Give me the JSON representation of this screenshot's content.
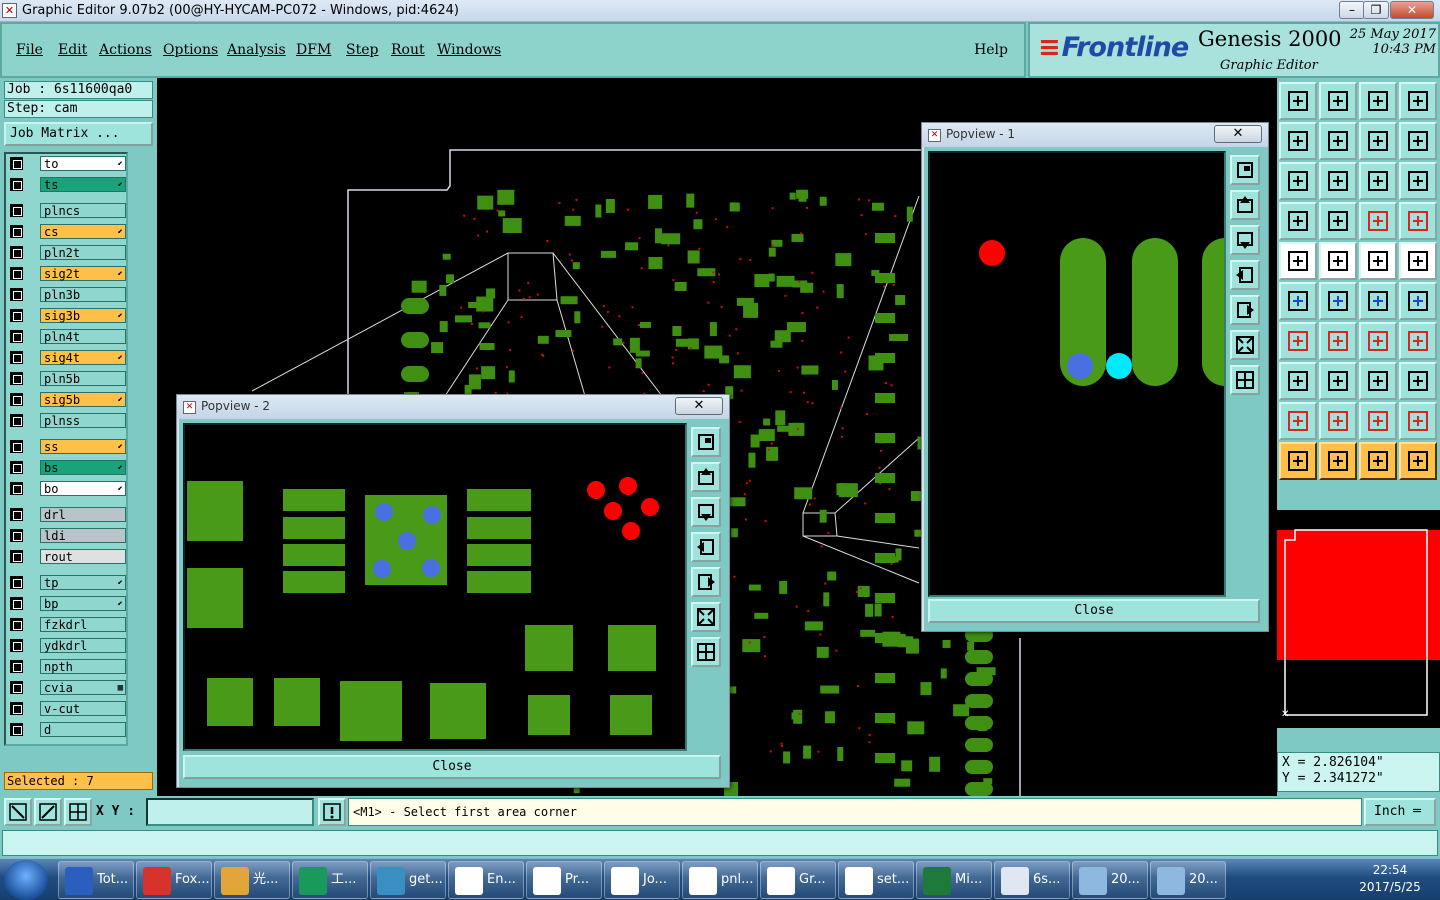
{
  "window": {
    "title": "Graphic Editor 9.07b2 (00@HY-HYCAM-PC072 - Windows, pid:4624)",
    "min": "–",
    "max": "❐",
    "close": "✕"
  },
  "menu": {
    "items": [
      "File",
      "Edit",
      "Actions",
      "Options",
      "Analysis",
      "DFM",
      "Step",
      "Rout",
      "Windows"
    ],
    "help": "Help"
  },
  "brand": {
    "logo": "Frontline",
    "product": "Genesis 2000",
    "subtitle": "Graphic Editor",
    "date": "25 May 2017",
    "time": "10:43 PM"
  },
  "job": {
    "job_line": "Job : 6s11600qa0",
    "step_line": "Step: cam",
    "matrix_button": "Job Matrix ..."
  },
  "layers": [
    {
      "name": "to",
      "color": "#ffffff",
      "mark": "⬋"
    },
    {
      "name": "ts",
      "color": "#1aa37a",
      "mark": "⬋"
    },
    {
      "name": "plncs",
      "color": "#8fd6cf",
      "mark": ""
    },
    {
      "name": "cs",
      "color": "#ffc04a",
      "mark": "⬋"
    },
    {
      "name": "pln2t",
      "color": "#8fd6cf",
      "mark": ""
    },
    {
      "name": "sig2t",
      "color": "#ffc04a",
      "mark": "⬋"
    },
    {
      "name": "pln3b",
      "color": "#8fd6cf",
      "mark": ""
    },
    {
      "name": "sig3b",
      "color": "#ffc04a",
      "mark": "⬋"
    },
    {
      "name": "pln4t",
      "color": "#8fd6cf",
      "mark": ""
    },
    {
      "name": "sig4t",
      "color": "#ffc04a",
      "mark": "⬋"
    },
    {
      "name": "pln5b",
      "color": "#8fd6cf",
      "mark": ""
    },
    {
      "name": "sig5b",
      "color": "#ffc04a",
      "mark": "⬋"
    },
    {
      "name": "plnss",
      "color": "#8fd6cf",
      "mark": ""
    },
    {
      "name": "ss",
      "color": "#ffc04a",
      "mark": "⬋"
    },
    {
      "name": "bs",
      "color": "#1aa37a",
      "mark": "⬋"
    },
    {
      "name": "bo",
      "color": "#ffffff",
      "mark": "⬋"
    },
    {
      "name": "drl",
      "color": "#b9c4c8",
      "mark": ""
    },
    {
      "name": "ldi",
      "color": "#b9c4c8",
      "mark": ""
    },
    {
      "name": "rout",
      "color": "#e0e0e0",
      "mark": ""
    },
    {
      "name": "tp",
      "color": "#8fd6cf",
      "mark": "⬋"
    },
    {
      "name": "bp",
      "color": "#8fd6cf",
      "mark": "⬋"
    },
    {
      "name": "fzkdrl",
      "color": "#8fd6cf",
      "mark": ""
    },
    {
      "name": "ydkdrl",
      "color": "#8fd6cf",
      "mark": ""
    },
    {
      "name": "npth",
      "color": "#8fd6cf",
      "mark": ""
    },
    {
      "name": "cvia",
      "color": "#8fd6cf",
      "mark": "▦"
    },
    {
      "name": "v-cut",
      "color": "#8fd6cf",
      "mark": ""
    },
    {
      "name": "d",
      "color": "#8fd6cf",
      "mark": ""
    }
  ],
  "selected": "Selected : 7",
  "popview1": {
    "title": "Popview - 1",
    "close": "Close",
    "x": "✕"
  },
  "popview2": {
    "title": "Popview - 2",
    "close": "Close",
    "x": "✕"
  },
  "coords": {
    "x_line": "X = 2.826104\"",
    "y_line": "Y = 2.341272\""
  },
  "status": {
    "xy_label": "X Y :",
    "xy_value": "",
    "prompt": "<M1> - Select first area corner",
    "unit": "Inch ═"
  },
  "taskbar": {
    "items": [
      {
        "label": "Tot...",
        "color": "#2b5fbf"
      },
      {
        "label": "Fox...",
        "color": "#d8332b"
      },
      {
        "label": "光...",
        "color": "#e2a53a"
      },
      {
        "label": "工...",
        "color": "#1a9a5a"
      },
      {
        "label": "get...",
        "color": "#3a8fc2"
      },
      {
        "label": "En...",
        "color": "#ffffff"
      },
      {
        "label": "Pr...",
        "color": "#ffffff"
      },
      {
        "label": "Jo...",
        "color": "#ffffff"
      },
      {
        "label": "pnl...",
        "color": "#ffffff"
      },
      {
        "label": "Gr...",
        "color": "#ffffff"
      },
      {
        "label": "set...",
        "color": "#ffffff"
      },
      {
        "label": "Mi...",
        "color": "#1e7a3a"
      },
      {
        "label": "6s...",
        "color": "#dfe7f2"
      },
      {
        "label": "20...",
        "color": "#8fb8e0"
      },
      {
        "label": "20...",
        "color": "#8fb8e0"
      }
    ],
    "time": "22:54",
    "date": "2017/5/25"
  }
}
